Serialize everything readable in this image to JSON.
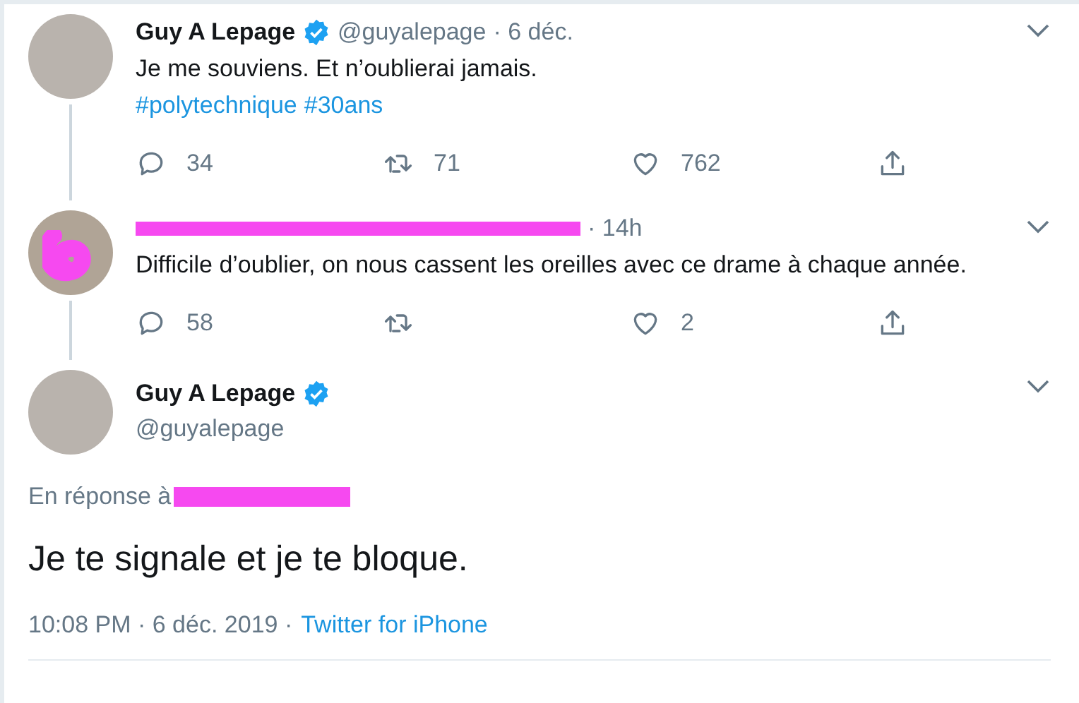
{
  "tweets": [
    {
      "kind": "tweet",
      "name": "Guy A Lepage",
      "verified": true,
      "handle": "@guyalepage",
      "time": "· 6 déc.",
      "redacted_header": false,
      "redacted_avatar": false,
      "text": "Je me souviens. Et n’oublierai jamais.",
      "hashtags": [
        "#polytechnique",
        "#30ans"
      ],
      "replies": "34",
      "retweets": "71",
      "likes": "762",
      "thread_line": true
    },
    {
      "kind": "tweet",
      "time": "· 14h",
      "redacted_header": true,
      "redacted_avatar": true,
      "text": "Difficile d’oublier, on nous cassent les oreilles avec ce drame à chaque année.",
      "replies": "58",
      "likes": "2",
      "thread_line": true
    }
  ],
  "focused": {
    "name": "Guy A Lepage",
    "verified": true,
    "handle": "@guyalepage",
    "reply_label": "En réponse à",
    "reply_redacted": true,
    "text": "Je te signale et je te bloque.",
    "timestamp": "10:08 PM · 6 déc. 2019 ·",
    "source": "Twitter for iPhone"
  }
}
